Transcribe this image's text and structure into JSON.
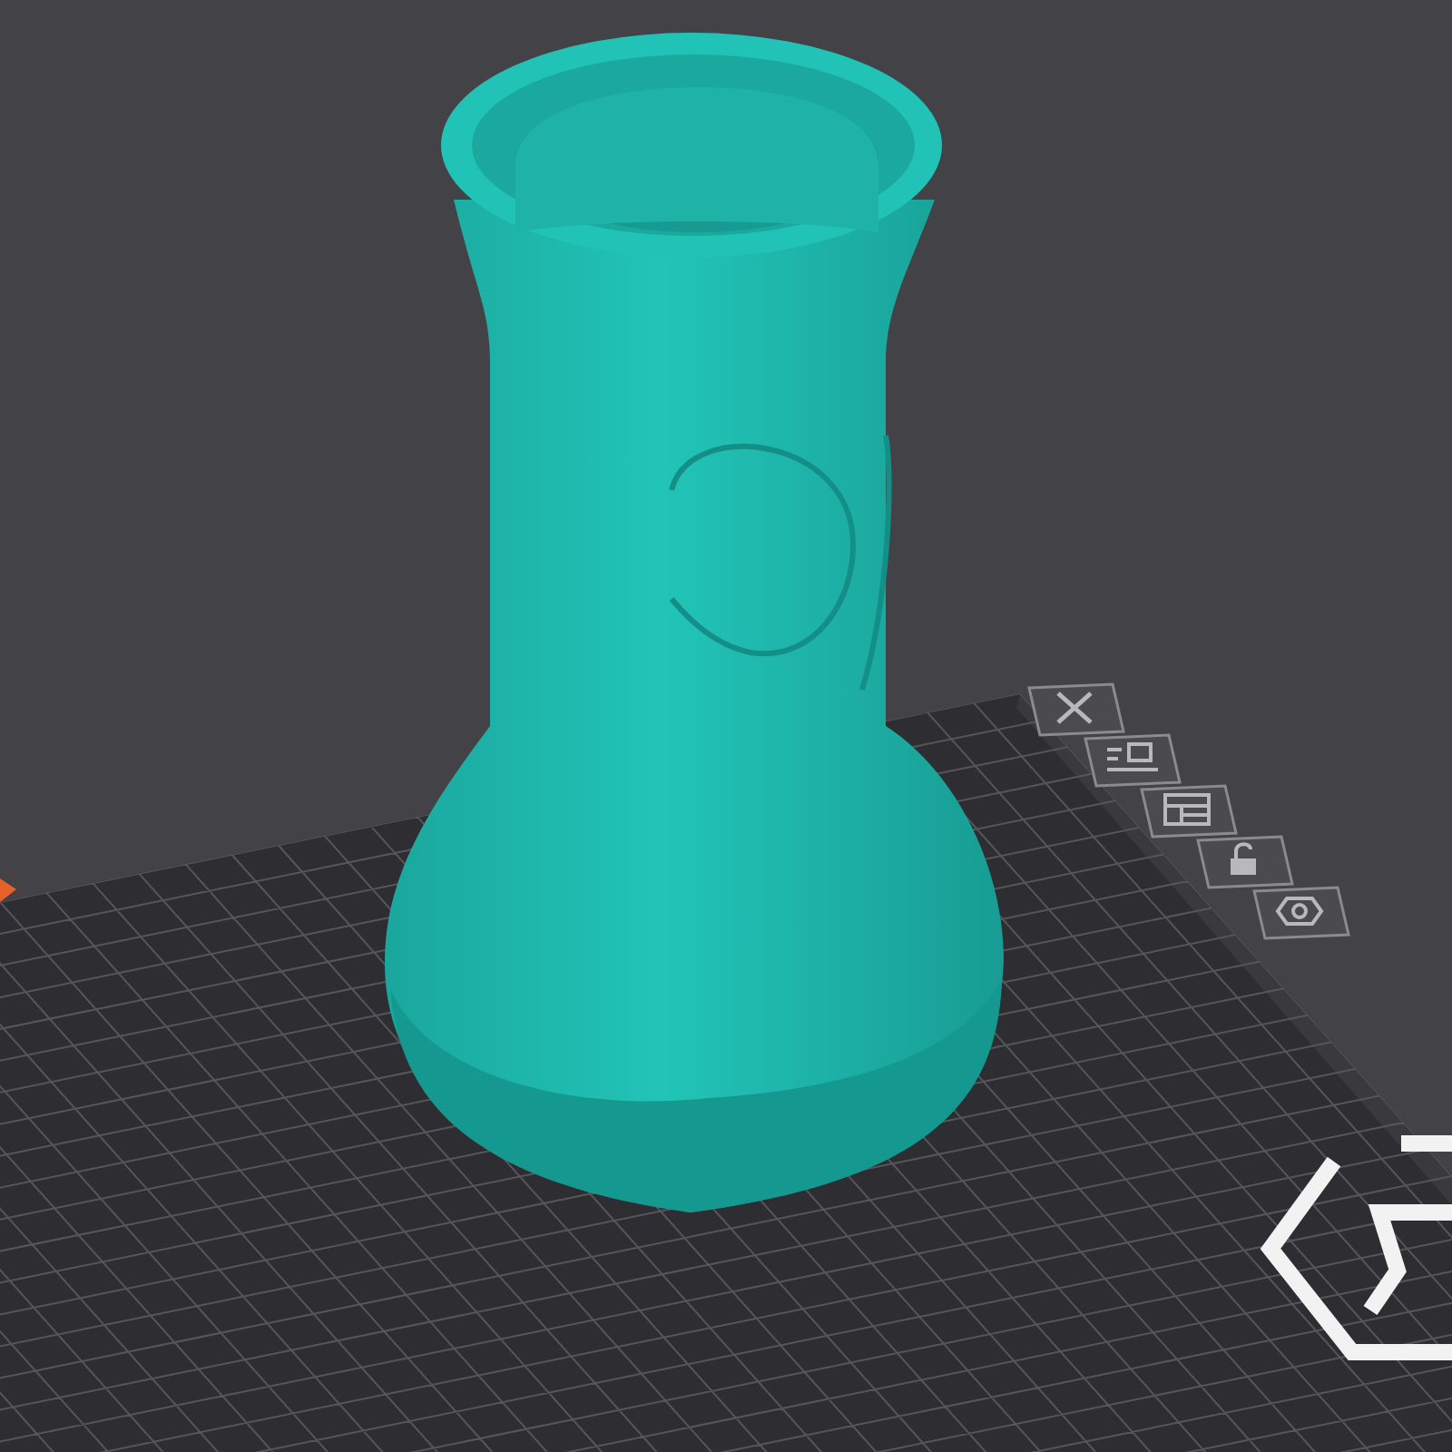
{
  "viewport": {
    "plate_tools": [
      {
        "kind": "delete"
      },
      {
        "kind": "arrange"
      },
      {
        "kind": "layout"
      },
      {
        "kind": "lock"
      },
      {
        "kind": "settings"
      }
    ]
  }
}
